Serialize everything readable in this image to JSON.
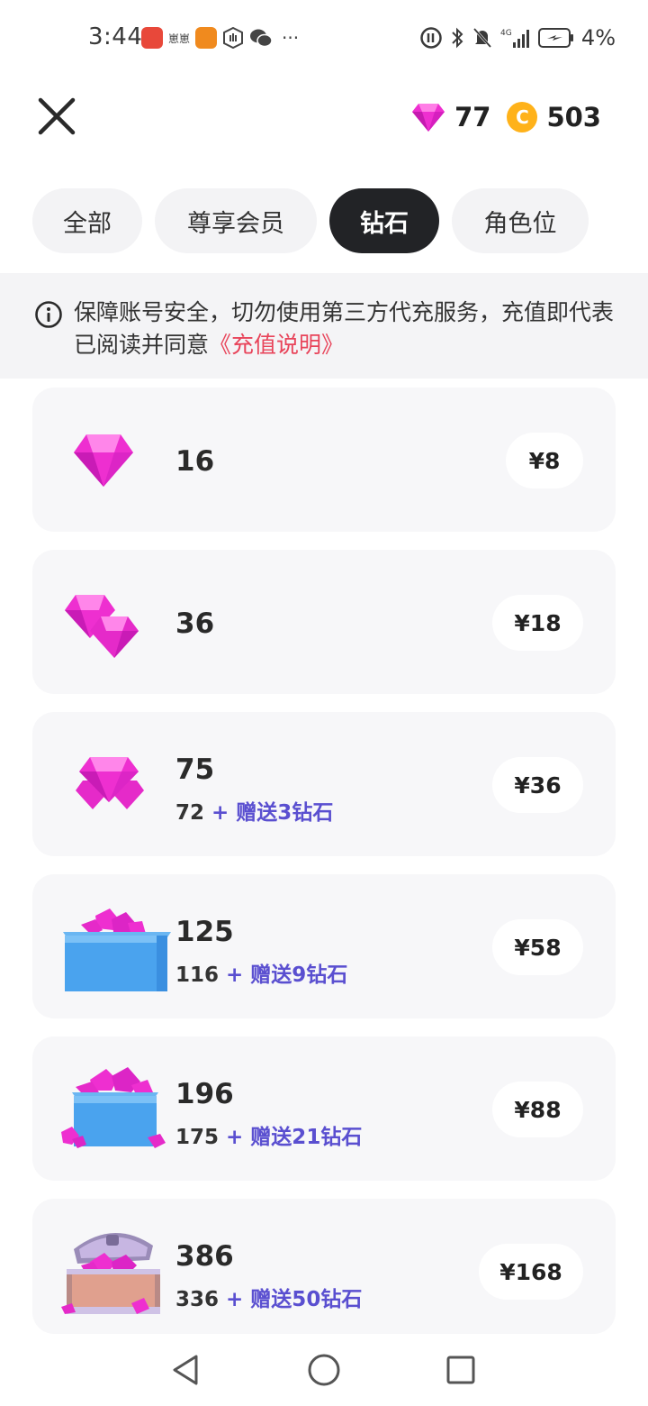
{
  "status_bar": {
    "time": "3:44",
    "app_text": "崽崽",
    "more": "···",
    "battery_percent": "4%",
    "network": "4G"
  },
  "header": {
    "diamond_balance": "77",
    "coin_balance": "503",
    "coin_symbol": "C"
  },
  "tabs": [
    {
      "label": "全部",
      "active": false
    },
    {
      "label": "尊享会员",
      "active": false
    },
    {
      "label": "钻石",
      "active": true
    },
    {
      "label": "角色位",
      "active": false
    }
  ],
  "notice": {
    "text": "保障账号安全，切勿使用第三方代充服务，充值即代表已阅读并同意",
    "link": "《充值说明》"
  },
  "packages": [
    {
      "amount": "16",
      "base": "",
      "bonus": "",
      "price": "¥8",
      "icon": "single-diamond-icon"
    },
    {
      "amount": "36",
      "base": "",
      "bonus": "",
      "price": "¥18",
      "icon": "two-diamonds-icon"
    },
    {
      "amount": "75",
      "base": "72",
      "bonus": "+ 赠送3钻石",
      "price": "¥36",
      "icon": "diamond-cluster-icon"
    },
    {
      "amount": "125",
      "base": "116",
      "bonus": "+ 赠送9钻石",
      "price": "¥58",
      "icon": "diamond-box-icon"
    },
    {
      "amount": "196",
      "base": "175",
      "bonus": "+ 赠送21钻石",
      "price": "¥88",
      "icon": "diamond-box-overflow-icon"
    },
    {
      "amount": "386",
      "base": "336",
      "bonus": "+ 赠送50钻石",
      "price": "¥168",
      "icon": "treasure-chest-icon"
    }
  ],
  "colors": {
    "accent_bonus": "#5a4fd0",
    "link": "#e8445a",
    "tab_active_bg": "#222326",
    "diamond": "#ee2fd0",
    "coin": "#ffb21a"
  }
}
